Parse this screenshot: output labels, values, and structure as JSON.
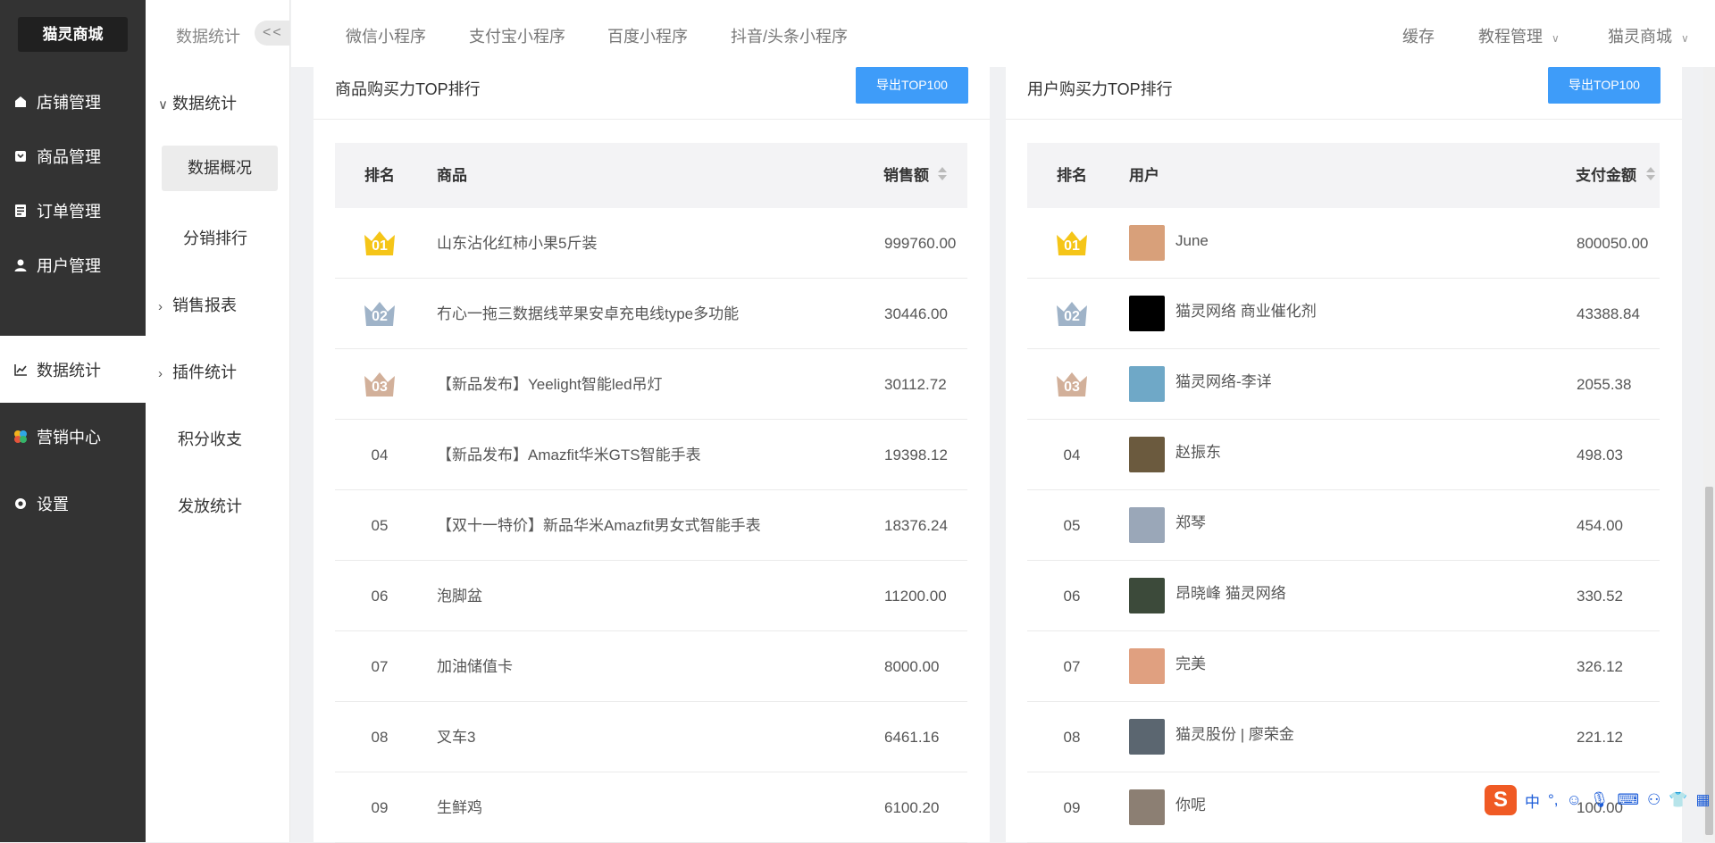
{
  "sidebar": {
    "logo": "猫灵商城",
    "items": [
      {
        "label": "店铺管理",
        "icon": "store-icon"
      },
      {
        "label": "商品管理",
        "icon": "product-icon"
      },
      {
        "label": "订单管理",
        "icon": "order-icon"
      },
      {
        "label": "用户管理",
        "icon": "user-icon"
      },
      {
        "label": "数据统计",
        "icon": "chart-icon",
        "active": true
      },
      {
        "label": "营销中心",
        "icon": "marketing-icon"
      },
      {
        "label": "设置",
        "icon": "gear-icon"
      }
    ]
  },
  "subnav": {
    "title": "数据统计",
    "collapse": "<<",
    "group": "数据统计",
    "items": [
      {
        "label": "数据概况",
        "active": true
      },
      {
        "label": "分销排行"
      },
      {
        "label": "销售报表",
        "expandable": true
      },
      {
        "label": "插件统计",
        "expandable": true
      },
      {
        "label": "积分收支"
      },
      {
        "label": "发放统计"
      }
    ]
  },
  "topbar": {
    "tabs": [
      "微信小程序",
      "支付宝小程序",
      "百度小程序",
      "抖音/头条小程序"
    ],
    "cache": "缓存",
    "tutorial": "教程管理",
    "shop": "猫灵商城"
  },
  "product_panel": {
    "title": "商品购买力TOP排行",
    "export_label": "导出TOP100",
    "columns": {
      "rank": "排名",
      "name": "商品",
      "amount": "销售额"
    },
    "rows": [
      {
        "rank": "01",
        "name": "山东沾化红柿小果5斤装",
        "amount": "999760.00"
      },
      {
        "rank": "02",
        "name": "冇心一拖三数据线苹果安卓充电线type多功能",
        "amount": "30446.00"
      },
      {
        "rank": "03",
        "name": "【新品发布】Yeelight智能led吊灯",
        "amount": "30112.72"
      },
      {
        "rank": "04",
        "name": "【新品发布】Amazfit华米GTS智能手表",
        "amount": "19398.12"
      },
      {
        "rank": "05",
        "name": "【双十一特价】新品华米Amazfit男女式智能手表",
        "amount": "18376.24"
      },
      {
        "rank": "06",
        "name": "泡脚盆",
        "amount": "11200.00"
      },
      {
        "rank": "07",
        "name": "加油储值卡",
        "amount": "8000.00"
      },
      {
        "rank": "08",
        "name": "叉车3",
        "amount": "6461.16"
      },
      {
        "rank": "09",
        "name": "生鲜鸡",
        "amount": "6100.20"
      }
    ]
  },
  "user_panel": {
    "title": "用户购买力TOP排行",
    "export_label": "导出TOP100",
    "columns": {
      "rank": "排名",
      "name": "用户",
      "amount": "支付金额"
    },
    "rows": [
      {
        "rank": "01",
        "name": "June",
        "amount": "800050.00"
      },
      {
        "rank": "02",
        "name": "猫灵网络 商业催化剂",
        "amount": "43388.84"
      },
      {
        "rank": "03",
        "name": "猫灵网络-李详",
        "amount": "2055.38"
      },
      {
        "rank": "04",
        "name": "赵振东",
        "amount": "498.03"
      },
      {
        "rank": "05",
        "name": "郑琴",
        "amount": "454.00"
      },
      {
        "rank": "06",
        "name": "昂晓峰 猫灵网络",
        "amount": "330.52"
      },
      {
        "rank": "07",
        "name": "完美",
        "amount": "326.12"
      },
      {
        "rank": "08",
        "name": "猫灵股份 | 廖荣金",
        "amount": "221.12"
      },
      {
        "rank": "09",
        "name": "你呢",
        "amount": "100.00"
      }
    ]
  },
  "colors": {
    "sidebar_bg": "#333333",
    "accent": "#3e9cf9",
    "gold": "#f5c518",
    "silver": "#9fb3c8",
    "bronze": "#d2b09a"
  },
  "ime": {
    "logo": "S",
    "mode": "中"
  }
}
